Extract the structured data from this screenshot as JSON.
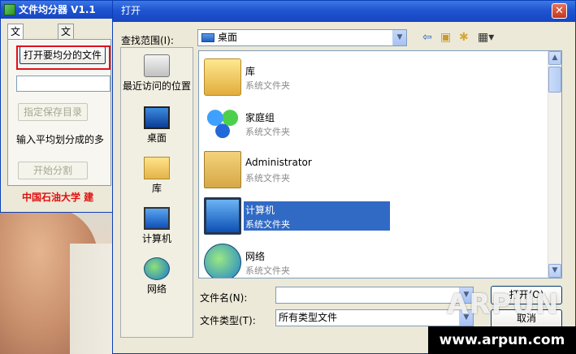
{
  "app": {
    "title": "文件均分器 V1.1",
    "tabs": [
      "文件分割",
      "文件合并"
    ],
    "open_file_button": "打开要均分的文件",
    "file_path_value": "",
    "save_dir_button": "指定保存目录",
    "split_hint": "输入平均划分成的多",
    "start_split_button": "开始分割",
    "footer": "中国石油大学   建"
  },
  "dialog": {
    "title": "打开",
    "close_glyph": "✕",
    "look_in_label": "查找范围(I):",
    "look_in_value": "桌面",
    "toolbar_icons": [
      "back-icon",
      "up-folder-icon",
      "new-folder-icon",
      "view-menu-icon"
    ],
    "places": [
      {
        "label": "最近访问的位置",
        "icon": "recent-icon"
      },
      {
        "label": "桌面",
        "icon": "desktop-icon"
      },
      {
        "label": "库",
        "icon": "library-icon"
      },
      {
        "label": "计算机",
        "icon": "computer-icon"
      },
      {
        "label": "网络",
        "icon": "network-icon"
      }
    ],
    "items": [
      {
        "name": "库",
        "kind": "系统文件夹",
        "icon": "library-icon",
        "selected": false
      },
      {
        "name": "家庭组",
        "kind": "系统文件夹",
        "icon": "homegroup-icon",
        "selected": false
      },
      {
        "name": "Administrator",
        "kind": "系统文件夹",
        "icon": "user-folder-icon",
        "selected": false
      },
      {
        "name": "计算机",
        "kind": "系统文件夹",
        "icon": "computer-icon",
        "selected": true
      },
      {
        "name": "网络",
        "kind": "系统文件夹",
        "icon": "network-icon",
        "selected": false
      }
    ],
    "filename_label": "文件名(N):",
    "filename_value": "",
    "filetype_label": "文件类型(T):",
    "filetype_value": "所有类型文件",
    "open_button": "打开(O)",
    "cancel_button": "取消"
  },
  "watermark": {
    "text": "ARPUN",
    "url": "www.arpun.com"
  },
  "colors": {
    "titlebar": "#1f55d1",
    "selection": "#316ac5",
    "highlight_red": "#e0111b",
    "footer_red": "#e01010"
  }
}
